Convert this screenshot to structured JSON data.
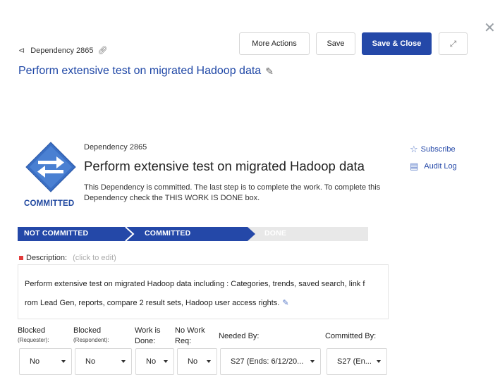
{
  "header": {
    "breadcrumb_id": "Dependency 2865",
    "title": "Perform extensive test on migrated Hadoop data"
  },
  "toolbar": {
    "more_actions": "More Actions",
    "save": "Save",
    "save_close": "Save & Close"
  },
  "icons": {
    "close": "close-icon",
    "dependency": "dependency-icon",
    "link": "link-icon",
    "edit": "pencil-icon",
    "expand": "expand-icon",
    "status": "swap-arrows-diamond-icon",
    "subscribe": "star-icon",
    "audit": "document-icon"
  },
  "colors": {
    "accent": "#2448a8",
    "title_link": "#1f47a6",
    "progress_active": "#2448a8",
    "progress_inactive": "#e8e8e8",
    "required": "#e23c3c"
  },
  "summary": {
    "id": "Dependency 2865",
    "title": "Perform extensive test on migrated Hadoop data",
    "status": "COMMITTED",
    "status_message": "This Dependency is committed. The last step is to complete the work. To complete this Dependency check the THIS WORK IS DONE box."
  },
  "side_links": {
    "subscribe": "Subscribe",
    "audit_log": "Audit Log"
  },
  "progress": {
    "steps": [
      {
        "label": "NOT COMMITTED",
        "state": "complete"
      },
      {
        "label": "COMMITTED",
        "state": "current"
      },
      {
        "label": "DONE",
        "state": "pending"
      }
    ]
  },
  "description": {
    "label": "Description:",
    "hint": "(click to edit)",
    "line1": "Perform extensive test on migrated Hadoop data including : Categories, trends, saved search, link f",
    "line2": "rom Lead Gen, reports, compare 2 result sets, Hadoop user access rights."
  },
  "fields": [
    {
      "label": "Blocked",
      "sublabel": "(Requester):",
      "value": "No"
    },
    {
      "label": "Blocked",
      "sublabel": "(Respondent):",
      "value": "No"
    },
    {
      "label": "Work is",
      "label2": "Done:",
      "value": "No"
    },
    {
      "label": "No Work",
      "label2": "Req:",
      "value": "No"
    },
    {
      "label": "Needed By:",
      "value": "S27 (Ends: 6/12/20..."
    },
    {
      "label": "Committed By:",
      "value": "S27 (En..."
    }
  ]
}
